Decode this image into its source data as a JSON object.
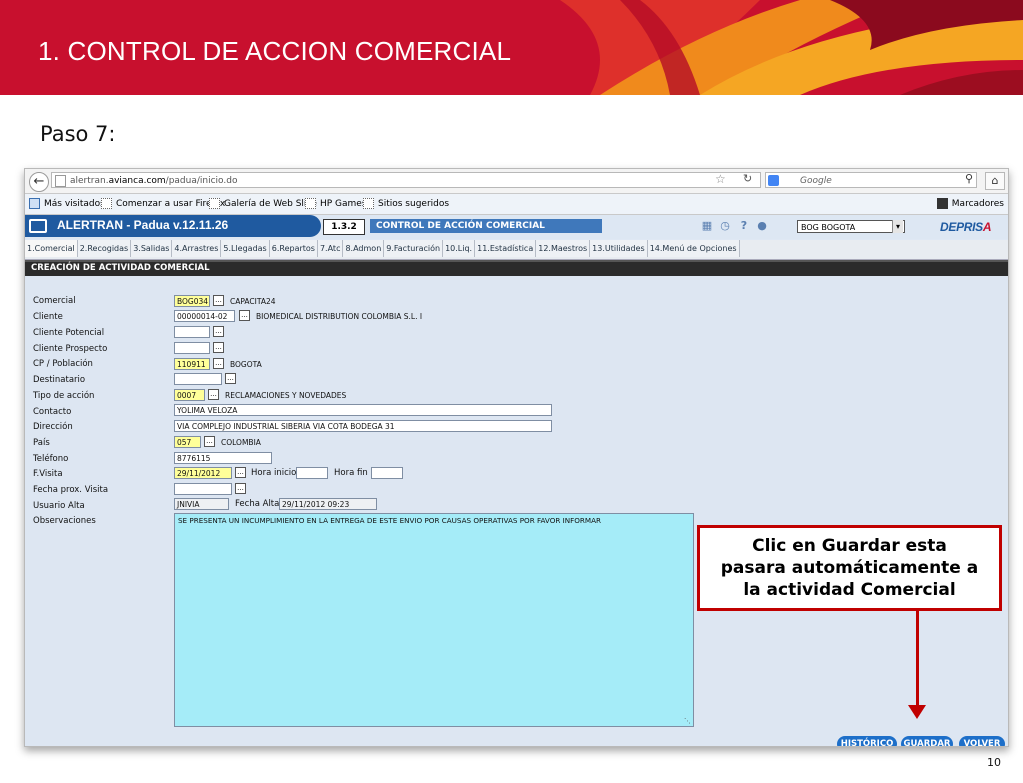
{
  "slide": {
    "title": "1. CONTROL  DE ACCION COMERCIAL",
    "step": "Paso 7:",
    "page_number": "10",
    "colors": {
      "header": "#c8102e",
      "callout_border": "#c00000"
    }
  },
  "browser": {
    "url_prefix": "alertran.",
    "url_domain": "avianca.com",
    "url_path": "/padua/inicio.do",
    "search_placeholder": "Google",
    "bookmarks": [
      "Más visitados",
      "Comenzar a usar Firefox",
      "Galería de Web Slice",
      "HP Games",
      "Sitios sugeridos"
    ],
    "bookmarks_right": "Marcadores",
    "icons": [
      "back-arrow-icon",
      "star-icon",
      "reload-icon",
      "search-icon",
      "home-icon"
    ]
  },
  "app": {
    "name": "ALERTRAN - Padua  v.12.11.26",
    "code": "1.3.2",
    "section": "CONTROL DE ACCIÓN COMERCIAL",
    "location": "BOG BOGOTA",
    "brand_main": "DEPRIS",
    "brand_last": "A",
    "menu": [
      "1.Comercial",
      "2.Recogidas",
      "3.Salidas",
      "4.Arrastres",
      "5.Llegadas",
      "6.Repartos",
      "7.Atc",
      "8.Admon",
      "9.Facturación",
      "10.Liq.",
      "11.Estadística",
      "12.Maestros",
      "13.Utilidades",
      "14.Menú de Opciones"
    ],
    "toolbar_icons": [
      "calendar-icon",
      "clock-icon",
      "help-icon",
      "user-icon"
    ]
  },
  "form": {
    "title": "CREACIÓN DE ACTIVIDAD COMERCIAL",
    "labels": {
      "comercial": "Comercial",
      "cliente": "Cliente",
      "cliente_potencial": "Cliente Potencial",
      "cliente_prospecto": "Cliente Prospecto",
      "cp": "CP / Población",
      "destinatario": "Destinatario",
      "tipo": "Tipo de acción",
      "contacto": "Contacto",
      "direccion": "Dirección",
      "pais": "País",
      "telefono": "Teléfono",
      "fvisita": "F.Visita",
      "fecha_prox": "Fecha prox. Visita",
      "usuario_alta": "Usuario Alta",
      "observaciones": "Observaciones",
      "hora_inicio": "Hora inicio",
      "hora_fin": "Hora fin",
      "fecha_alta": "Fecha Alta"
    },
    "values": {
      "comercial_code": "BOG034",
      "comercial_name": "CAPACITA24",
      "cliente_code": "00000014-02",
      "cliente_name": "BIOMEDICAL DISTRIBUTION COLOMBIA S.L. I",
      "cliente_potencial": "",
      "cliente_prospecto": "",
      "cp_code": "110911",
      "cp_name": "BOGOTA",
      "destinatario": "",
      "tipo_code": "0007",
      "tipo_name": "RECLAMACIONES Y NOVEDADES",
      "contacto": "YOLIMA VELOZA",
      "direccion": "VIA COMPLEJO INDUSTRIAL SIBERIA VIA COTA BODEGA 31",
      "pais_code": "057",
      "pais_name": "COLOMBIA",
      "telefono": "8776115",
      "fvisita": "29/11/2012",
      "hora_inicio": "",
      "hora_fin": "",
      "fecha_prox": "",
      "usuario_alta": "JNIVIA",
      "fecha_alta": "29/11/2012 09:23",
      "observaciones": "SE PRESENTA UN INCUMPLIMIENTO EN LA ENTREGA DE ESTE ENVIO POR CAUSAS OPERATIVAS POR FAVOR INFORMAR"
    },
    "lookup_button": "...",
    "buttons": {
      "historico": "HISTÓRICO",
      "guardar": "GUARDAR",
      "volver": "VOLVER"
    }
  },
  "callout": {
    "line1": "Clic en Guardar esta",
    "line2": "pasara automáticamente a",
    "line3": "la actividad Comercial"
  }
}
